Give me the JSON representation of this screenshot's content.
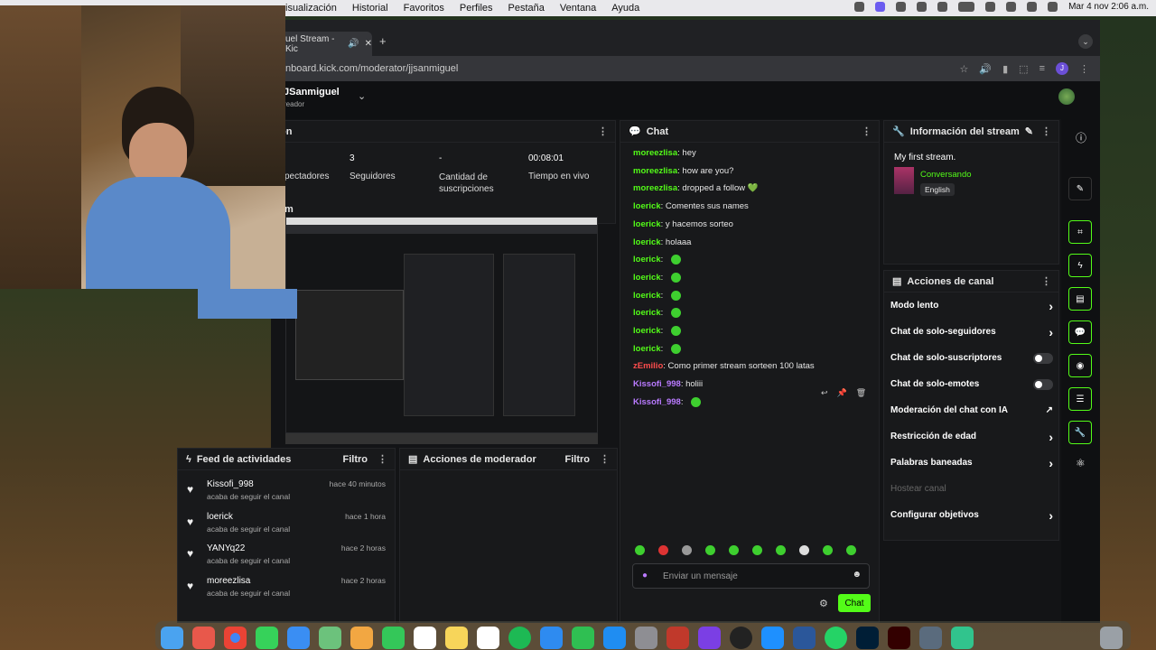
{
  "menubar": {
    "items": [
      "isualización",
      "Historial",
      "Favoritos",
      "Perfiles",
      "Pestaña",
      "Ventana",
      "Ayuda"
    ],
    "clock": "Mar 4 nov 2:06 a.m."
  },
  "browser": {
    "tab_title": "uel Stream - Kic",
    "url": "nboard.kick.com/moderator/jjsanmiguel"
  },
  "header": {
    "channel": "JSanmiguel",
    "role": "reador"
  },
  "stats": {
    "title_fragment": "ón",
    "items": [
      {
        "value": "",
        "label": "pectadores"
      },
      {
        "value": "3",
        "label": "Seguidores"
      },
      {
        "value": "-",
        "label": "Cantidad de suscripciones"
      },
      {
        "value": "00:08:01",
        "label": "Tiempo en vivo"
      }
    ],
    "preview_label": "m"
  },
  "chat": {
    "title": "Chat",
    "messages": [
      {
        "user": "moreezlisa",
        "text": "hey",
        "color": "#53fc18"
      },
      {
        "user": "moreezlisa",
        "text": "how are you?",
        "color": "#53fc18"
      },
      {
        "user": "moreezlisa",
        "text": "dropped a follow 💚",
        "color": "#53fc18"
      },
      {
        "user": "loerick",
        "text": "Comentes sus names",
        "color": "#53fc18"
      },
      {
        "user": "loerick",
        "text": "y hacemos sorteo",
        "color": "#53fc18"
      },
      {
        "user": "loerick",
        "text": "holaaa",
        "color": "#53fc18"
      },
      {
        "user": "loerick",
        "text": "",
        "color": "#53fc18"
      },
      {
        "user": "loerick",
        "text": "",
        "color": "#53fc18"
      },
      {
        "user": "loerick",
        "text": "",
        "color": "#53fc18"
      },
      {
        "user": "loerick",
        "text": "",
        "color": "#53fc18"
      },
      {
        "user": "loerick",
        "text": "",
        "color": "#53fc18"
      },
      {
        "user": "loerick",
        "text": "",
        "color": "#53fc18"
      },
      {
        "user": "zEmilio",
        "text": "Como primer stream sorteen 100 latas",
        "color": "#ff4d4d"
      },
      {
        "user": "Kissofi_998",
        "text": "holiii",
        "color": "#b97aff"
      },
      {
        "user": "Kissofi_998",
        "text": "",
        "color": "#b97aff"
      }
    ],
    "input_placeholder": "Enviar un mensaje",
    "send_label": "Chat"
  },
  "stream_info": {
    "title": "Información del stream",
    "stream_title": "My first stream.",
    "category": "Conversando",
    "language": "English"
  },
  "channel_actions": {
    "title": "Acciones de canal",
    "rows": [
      {
        "label": "Modo lento",
        "kind": "arrow"
      },
      {
        "label": "Chat de solo-seguidores",
        "kind": "arrow"
      },
      {
        "label": "Chat de solo-suscriptores",
        "kind": "toggle"
      },
      {
        "label": "Chat de solo-emotes",
        "kind": "toggle"
      },
      {
        "label": "Moderación del chat con IA",
        "kind": "link"
      },
      {
        "label": "Restricción de edad",
        "kind": "arrow"
      },
      {
        "label": "Palabras baneadas",
        "kind": "arrow"
      },
      {
        "label": "Hostear canal",
        "kind": "disabled"
      },
      {
        "label": "Configurar objetivos",
        "kind": "arrow"
      }
    ]
  },
  "activity": {
    "title": "Feed de actividades",
    "filter": "Filtro",
    "items": [
      {
        "name": "Kissofi_998",
        "sub": "acaba de seguir el canal",
        "time": "hace 40 minutos"
      },
      {
        "name": "loerick",
        "sub": "acaba de seguir el canal",
        "time": "hace 1 hora"
      },
      {
        "name": "YANYq22",
        "sub": "acaba de seguir el canal",
        "time": "hace 2 horas"
      },
      {
        "name": "moreezlisa",
        "sub": "acaba de seguir el canal",
        "time": "hace 2 horas"
      }
    ]
  },
  "mod_actions": {
    "title": "Acciones de moderador",
    "filter": "Filtro"
  },
  "colors": {
    "accent": "#53fc18",
    "panel": "#18191b",
    "bg": "#0f1012"
  }
}
